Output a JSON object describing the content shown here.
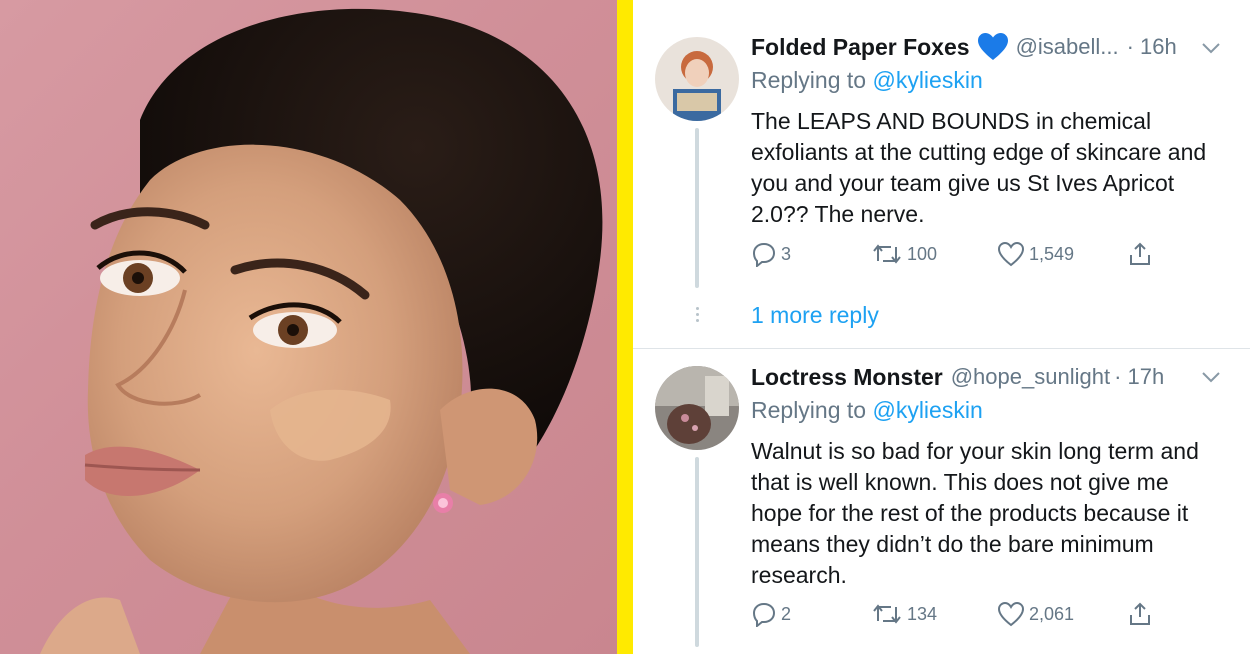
{
  "photo": {
    "description_icon": "portrait-photo"
  },
  "tweets": [
    {
      "name": "Folded Paper Foxes",
      "handle": "@isabell...",
      "time": "· 16h",
      "replying_prefix": "Replying to ",
      "replying_handle": "@kylieskin",
      "text": "The LEAPS AND BOUNDS in chemical exfoliants at the cutting edge of skincare and you and your team give us St Ives Apricot 2.0?? The nerve.",
      "replies": "3",
      "retweets": "100",
      "likes": "1,549"
    },
    {
      "name": "Loctress Monster",
      "handle": "@hope_sunlight",
      "time": "· 17h",
      "replying_prefix": "Replying to ",
      "replying_handle": "@kylieskin",
      "text": "Walnut is so bad for your skin long term and that is well known. This does not give me hope for the rest of the products because it means they didn’t do the bare minimum research.",
      "replies": "2",
      "retweets": "134",
      "likes": "2,061"
    }
  ],
  "more_replies": "1 more reply",
  "colors": {
    "accent": "#1da1f2",
    "divider": "#ffea00",
    "muted": "#657786",
    "heart_emoji": "#1b7be8"
  }
}
